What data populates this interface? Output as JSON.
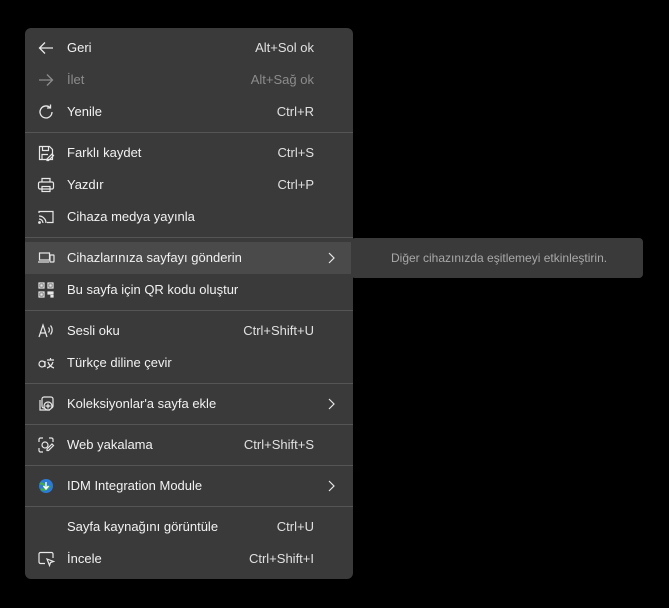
{
  "menu": {
    "items": [
      {
        "id": "back",
        "label": "Geri",
        "shortcut": "Alt+Sol ok",
        "icon": "arrow-left-icon"
      },
      {
        "id": "forward",
        "label": "İlet",
        "shortcut": "Alt+Sağ ok",
        "icon": "arrow-right-icon",
        "disabled": true
      },
      {
        "id": "refresh",
        "label": "Yenile",
        "shortcut": "Ctrl+R",
        "icon": "refresh-icon"
      },
      {
        "id": "save-as",
        "label": "Farklı kaydet",
        "shortcut": "Ctrl+S",
        "icon": "save-icon"
      },
      {
        "id": "print",
        "label": "Yazdır",
        "shortcut": "Ctrl+P",
        "icon": "printer-icon"
      },
      {
        "id": "cast",
        "label": "Cihaza medya yayınla",
        "shortcut": "",
        "icon": "cast-icon"
      },
      {
        "id": "send-to-devices",
        "label": "Cihazlarınıza sayfayı gönderin",
        "shortcut": "",
        "icon": "laptop-phone-icon",
        "submenu": true
      },
      {
        "id": "qr-code",
        "label": "Bu sayfa için QR kodu oluştur",
        "shortcut": "",
        "icon": "qr-code-icon"
      },
      {
        "id": "read-aloud",
        "label": "Sesli oku",
        "shortcut": "Ctrl+Shift+U",
        "icon": "read-aloud-icon"
      },
      {
        "id": "translate",
        "label": "Türkçe diline çevir",
        "shortcut": "",
        "icon": "translate-icon"
      },
      {
        "id": "collections",
        "label": "Koleksiyonlar'a sayfa ekle",
        "shortcut": "",
        "icon": "collections-add-icon",
        "submenu": true
      },
      {
        "id": "web-capture",
        "label": "Web yakalama",
        "shortcut": "Ctrl+Shift+S",
        "icon": "web-capture-icon"
      },
      {
        "id": "idm",
        "label": "IDM Integration Module",
        "shortcut": "",
        "icon": "idm-globe-icon",
        "submenu": true
      },
      {
        "id": "view-source",
        "label": "Sayfa kaynağını görüntüle",
        "shortcut": "Ctrl+U",
        "icon": ""
      },
      {
        "id": "inspect",
        "label": "İncele",
        "shortcut": "Ctrl+Shift+I",
        "icon": "inspect-icon"
      }
    ]
  },
  "submenu": {
    "label": "Diğer cihazınızda eşitlemeyi etkinleştirin."
  },
  "colors": {
    "background": "#000000",
    "menu_bg": "#3a3a3a",
    "hover_bg": "#4a4a4a",
    "separator": "#555555",
    "text": "#f2f2f2",
    "disabled_text": "#8c8c8c"
  }
}
